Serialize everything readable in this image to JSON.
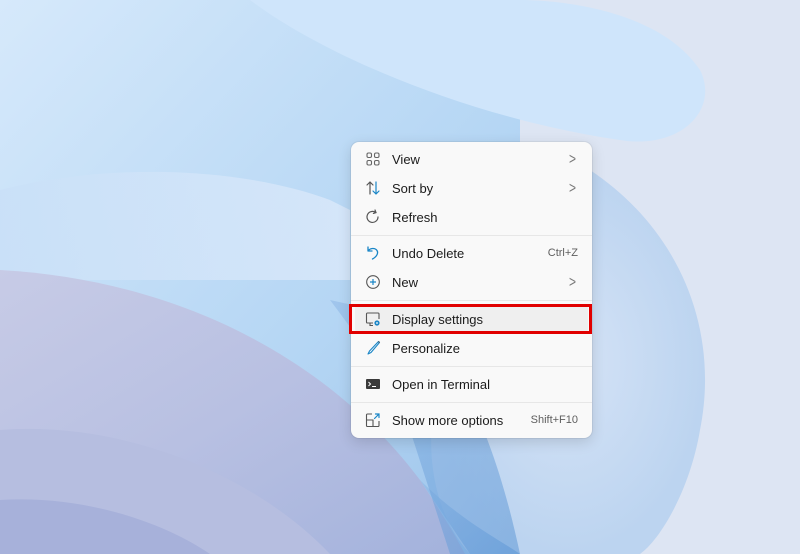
{
  "desktop": {
    "wallpaper": "windows-11-bloom-light"
  },
  "context_menu": {
    "groups": [
      {
        "items": [
          {
            "label": "View",
            "icon": "view-grid-icon",
            "has_submenu": true,
            "shortcut": ""
          },
          {
            "label": "Sort by",
            "icon": "sort-arrows-icon",
            "has_submenu": true,
            "shortcut": ""
          },
          {
            "label": "Refresh",
            "icon": "refresh-icon",
            "has_submenu": false,
            "shortcut": ""
          }
        ]
      },
      {
        "items": [
          {
            "label": "Undo Delete",
            "icon": "undo-icon",
            "has_submenu": false,
            "shortcut": "Ctrl+Z"
          },
          {
            "label": "New",
            "icon": "plus-circle-icon",
            "has_submenu": true,
            "shortcut": ""
          }
        ]
      },
      {
        "items": [
          {
            "label": "Display settings",
            "icon": "display-settings-icon",
            "has_submenu": false,
            "shortcut": "",
            "highlighted": true
          },
          {
            "label": "Personalize",
            "icon": "brush-icon",
            "has_submenu": false,
            "shortcut": ""
          }
        ]
      },
      {
        "items": [
          {
            "label": "Open in Terminal",
            "icon": "terminal-icon",
            "has_submenu": false,
            "shortcut": ""
          }
        ]
      },
      {
        "items": [
          {
            "label": "Show more options",
            "icon": "show-more-icon",
            "has_submenu": false,
            "shortcut": "Shift+F10"
          }
        ]
      }
    ],
    "chevron_glyph": ">",
    "highlight_color": "#e10000",
    "accent_color": "#1a86c7"
  }
}
